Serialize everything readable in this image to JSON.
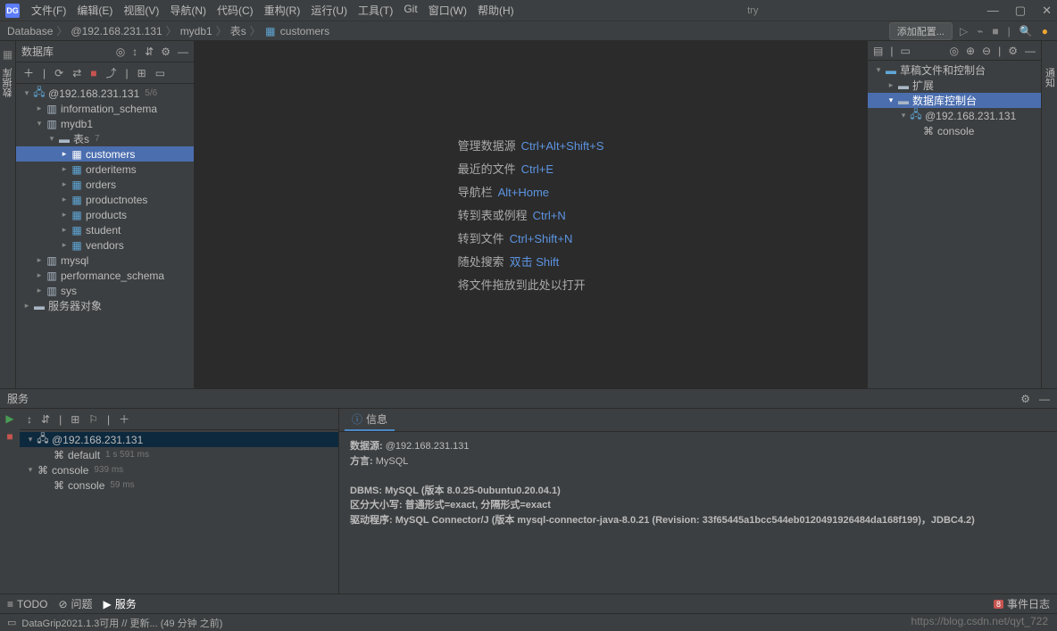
{
  "titlebar": {
    "logo": "DG",
    "menu": [
      "文件(F)",
      "编辑(E)",
      "视图(V)",
      "导航(N)",
      "代码(C)",
      "重构(R)",
      "运行(U)",
      "工具(T)",
      "Git",
      "窗口(W)",
      "帮助(H)"
    ],
    "title": "try"
  },
  "breadcrumb": [
    "Database",
    "@192.168.231.131",
    "mydb1",
    "表s",
    "customers"
  ],
  "breadcrumb_icon_last": "table-icon",
  "nav_right": {
    "config": "添加配置..."
  },
  "left_panel": {
    "title": "数据库",
    "tree": [
      {
        "indent": 0,
        "arrow": "v",
        "icon": "db",
        "label": "@192.168.231.131",
        "dim": "5/6"
      },
      {
        "indent": 1,
        "arrow": ">",
        "icon": "schema",
        "label": "information_schema"
      },
      {
        "indent": 1,
        "arrow": "v",
        "icon": "schema",
        "label": "mydb1"
      },
      {
        "indent": 2,
        "arrow": "v",
        "icon": "folder",
        "label": "表s",
        "dim": "7"
      },
      {
        "indent": 3,
        "arrow": ">",
        "icon": "table",
        "label": "customers",
        "selected": true
      },
      {
        "indent": 3,
        "arrow": ">",
        "icon": "table",
        "label": "orderitems"
      },
      {
        "indent": 3,
        "arrow": ">",
        "icon": "table",
        "label": "orders"
      },
      {
        "indent": 3,
        "arrow": ">",
        "icon": "table",
        "label": "productnotes"
      },
      {
        "indent": 3,
        "arrow": ">",
        "icon": "table",
        "label": "products"
      },
      {
        "indent": 3,
        "arrow": ">",
        "icon": "table",
        "label": "student"
      },
      {
        "indent": 3,
        "arrow": ">",
        "icon": "table",
        "label": "vendors"
      },
      {
        "indent": 1,
        "arrow": ">",
        "icon": "schema",
        "label": "mysql"
      },
      {
        "indent": 1,
        "arrow": ">",
        "icon": "schema",
        "label": "performance_schema"
      },
      {
        "indent": 1,
        "arrow": ">",
        "icon": "schema",
        "label": "sys"
      },
      {
        "indent": 0,
        "arrow": ">",
        "icon": "folder",
        "label": "服务器对象"
      }
    ]
  },
  "left_vertical": {
    "label": "数据库"
  },
  "editor_hints": [
    {
      "text": "管理数据源",
      "key": "Ctrl+Alt+Shift+S"
    },
    {
      "text": "最近的文件",
      "key": "Ctrl+E"
    },
    {
      "text": "导航栏",
      "key": "Alt+Home"
    },
    {
      "text": "转到表或例程",
      "key": "Ctrl+N"
    },
    {
      "text": "转到文件",
      "key": "Ctrl+Shift+N"
    },
    {
      "text": "随处搜索",
      "key": "双击 Shift"
    },
    {
      "text": "将文件拖放到此处以打开",
      "key": ""
    }
  ],
  "right_panel": {
    "tree": [
      {
        "indent": 0,
        "arrow": "v",
        "icon": "folder-blue",
        "label": "草稿文件和控制台"
      },
      {
        "indent": 1,
        "arrow": ">",
        "icon": "folder",
        "label": "扩展"
      },
      {
        "indent": 1,
        "arrow": "v",
        "icon": "folder",
        "label": "数据库控制台",
        "selected": true
      },
      {
        "indent": 2,
        "arrow": "v",
        "icon": "db",
        "label": "@192.168.231.131"
      },
      {
        "indent": 3,
        "arrow": "",
        "icon": "cons",
        "label": "console"
      }
    ]
  },
  "right_vertical": {
    "label": "通知"
  },
  "services": {
    "title": "服务",
    "tree": [
      {
        "indent": 0,
        "arrow": "v",
        "icon": "db",
        "label": "@192.168.231.131",
        "sel": true
      },
      {
        "indent": 1,
        "arrow": "",
        "icon": "cons",
        "label": "default",
        "time": "1 s 591 ms"
      },
      {
        "indent": 0,
        "arrow": "v",
        "icon": "cons",
        "label": "console",
        "time": "939 ms"
      },
      {
        "indent": 1,
        "arrow": "",
        "icon": "cons",
        "label": "console",
        "time": "59 ms"
      }
    ],
    "info_tab": "信息",
    "info": {
      "datasource_label": "数据源:",
      "datasource": "@192.168.231.131",
      "dialect_label": "方言:",
      "dialect": "MySQL",
      "dbms": "DBMS: MySQL (版本 8.0.25-0ubuntu0.20.04.1)",
      "case": "区分大小写: 普通形式=exact, 分隔形式=exact",
      "driver": "驱动程序: MySQL Connector/J (版本 mysql-connector-java-8.0.21 (Revision: 33f65445a1bcc544eb0120491926484da168f199)，JDBC4.2)"
    }
  },
  "statusbar": {
    "tabs": [
      {
        "icon": "≡",
        "label": "TODO"
      },
      {
        "icon": "⊘",
        "label": "问题"
      },
      {
        "icon": "▶",
        "label": "服务",
        "sel": true
      }
    ],
    "event_badge": "8",
    "event_label": "事件日志"
  },
  "bottom": {
    "status": "DataGrip2021.1.3可用 // 更新... (49 分钟 之前)"
  },
  "watermark": "https://blog.csdn.net/qyt_722"
}
